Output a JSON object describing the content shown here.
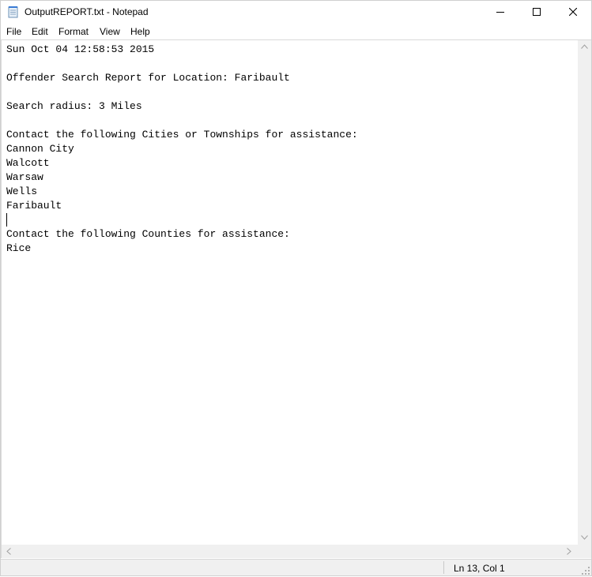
{
  "window": {
    "title": "OutputREPORT.txt - Notepad",
    "app_icon": "notepad-icon",
    "controls": {
      "minimize_icon": "minimize-icon",
      "maximize_icon": "maximize-icon",
      "close_icon": "close-icon"
    }
  },
  "menu": {
    "file": "File",
    "edit": "Edit",
    "format": "Format",
    "view": "View",
    "help": "Help"
  },
  "editor": {
    "content": "Sun Oct 04 12:58:53 2015\n\nOffender Search Report for Location: Faribault\n\nSearch radius: 3 Miles\n\nContact the following Cities or Townships for assistance:\nCannon City\nWalcott\nWarsaw\nWells\nFaribault\n\nContact the following Counties for assistance:\nRice"
  },
  "status": {
    "position": "Ln 13, Col 1"
  }
}
